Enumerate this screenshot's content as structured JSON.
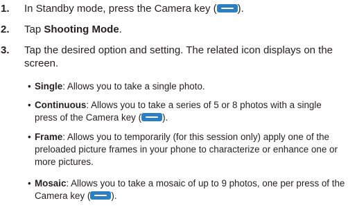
{
  "steps": [
    {
      "number": "1.",
      "text_before": "In Standby mode, press the Camera key (",
      "key_icon": "camera-key-icon",
      "text_after": ")."
    },
    {
      "number": "2.",
      "text_before": "Tap ",
      "bold": "Shooting Mode",
      "text_after": "."
    },
    {
      "number": "3.",
      "text": "Tap the desired option and setting.  The related icon displays on the screen."
    }
  ],
  "bullets": [
    {
      "term": "Single",
      "desc": ": Allows you to take a single photo."
    },
    {
      "term": "Continuous",
      "desc": ": Allows you to take a series of 5 or 8 photos with a single press of the Camera key (",
      "key_icon": "camera-key-icon",
      "desc_after": ")."
    },
    {
      "term": "Frame",
      "desc": ": Allows you to temporarily (for this session only) apply one of the preloaded picture frames in your phone to characterize or enhance one or more pictures."
    },
    {
      "term": "Mosaic",
      "desc": ": Allows you to take a mosaic of up to 9 photos, one per press of the Camera key (",
      "key_icon": "camera-key-icon",
      "desc_after": ")."
    }
  ],
  "bullet_char": "•",
  "colors": {
    "text": "#231f20",
    "key_icon": "#2d7fc1"
  }
}
